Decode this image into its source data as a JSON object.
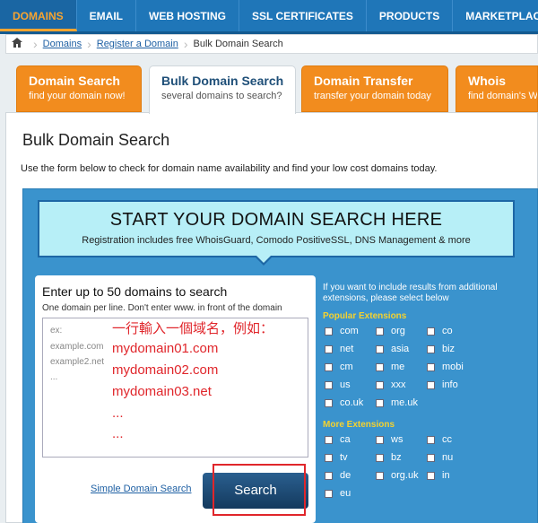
{
  "nav": [
    "DOMAINS",
    "EMAIL",
    "WEB HOSTING",
    "SSL CERTIFICATES",
    "PRODUCTS",
    "MARKETPLACE"
  ],
  "breadcrumb": {
    "home_icon": "home-icon",
    "links": [
      "Domains",
      "Register a Domain"
    ],
    "current": "Bulk Domain Search"
  },
  "tabs": [
    {
      "title": "Domain Search",
      "sub": "find your domain now!"
    },
    {
      "title": "Bulk Domain Search",
      "sub": "several domains to search?"
    },
    {
      "title": "Domain Transfer",
      "sub": "transfer your domain today"
    },
    {
      "title": "Whois",
      "sub": "find domain's W"
    }
  ],
  "page": {
    "title": "Bulk Domain Search",
    "intro": "Use the form below to check for domain name availability and find your low cost domains today."
  },
  "banner": {
    "heading": "START YOUR DOMAIN SEARCH HERE",
    "sub": "Registration includes free WhoisGuard, Comodo PositiveSSL, DNS Management & more"
  },
  "form": {
    "heading": "Enter up to 50 domains to search",
    "sub": "One domain per line. Don't enter www. in front of the domain",
    "placeholder_lines": [
      "ex:",
      "example.com",
      "example2.net",
      "..."
    ],
    "annotation": [
      "一行輸入一個域名，例如：",
      "mydomain01.com",
      "mydomain02.com",
      "mydomain03.net",
      "...",
      "..."
    ],
    "simple_link": "Simple Domain Search",
    "search_button": "Search"
  },
  "extensions": {
    "intro": "If you want to include results from additional extensions, please select below",
    "popular_label": "Popular Extensions",
    "popular": [
      "com",
      "org",
      "co",
      "net",
      "asia",
      "biz",
      "cm",
      "me",
      "mobi",
      "us",
      "xxx",
      "info",
      "co.uk",
      "me.uk"
    ],
    "more_label": "More Extensions",
    "more": [
      "ca",
      "ws",
      "cc",
      "tv",
      "bz",
      "nu",
      "de",
      "org.uk",
      "in",
      "eu"
    ]
  },
  "colors": {
    "nav": "#1f76b8",
    "tab_orange": "#f28c1e",
    "panel_blue": "#3a93cd",
    "annotation_red": "#e0262b",
    "ext_heading": "#f5d22f"
  }
}
